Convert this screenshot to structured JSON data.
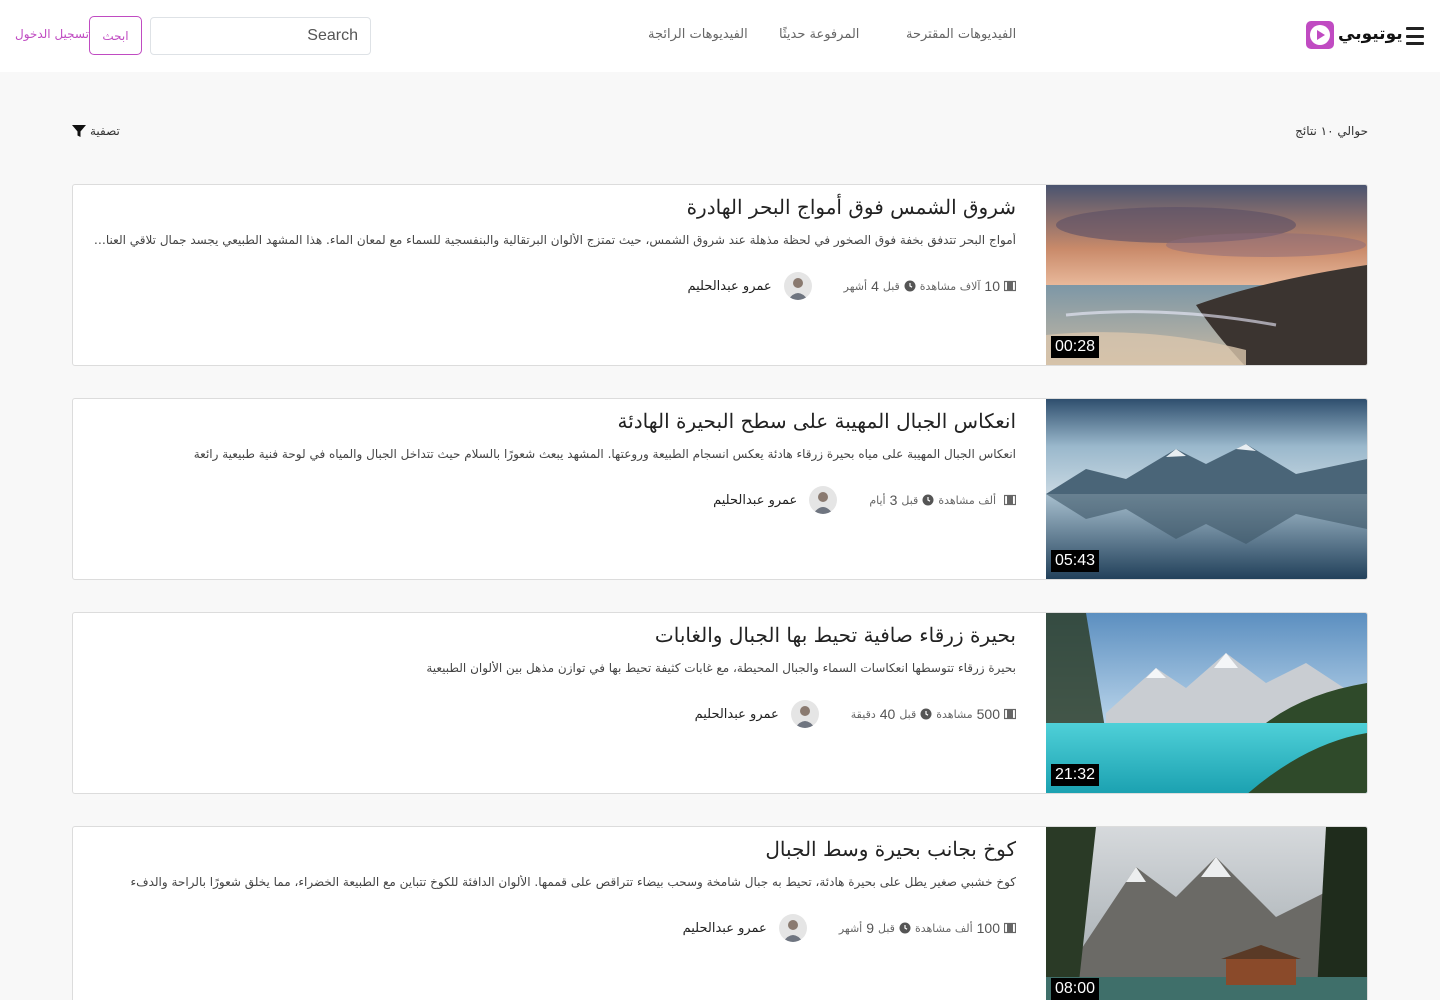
{
  "navbar": {
    "brand": "يوتيوبي",
    "colors": {
      "accent": "#c04bc2"
    },
    "links": [
      {
        "label": "الفيديوهات المقترحة"
      },
      {
        "label": "المرفوعة حديثًا"
      },
      {
        "label": "الفيديوهات الرائجة"
      }
    ],
    "search": {
      "placeholder": "Search",
      "value": "",
      "button_label": "ابحث"
    },
    "login_label": "تسجيل الدخول"
  },
  "results": {
    "count_label": "حوالي ١٠ نتائج",
    "filter_label": "تصفية"
  },
  "videos": [
    {
      "title": "شروق الشمس فوق أمواج البحر الهادرة",
      "description": "أمواج البحر تتدفق بخفة فوق الصخور في لحظة مذهلة عند شروق الشمس، حيث تمتزج الألوان البرتقالية والبنفسجية للسماء مع لمعان الماء. هذا المشهد الطبيعي يجسد جمال تلاقي العناصر الطبيعية",
      "views_num": "10",
      "views_unit": "آلاف مشاهدة",
      "time_prefix": "قبل",
      "time_num": "4",
      "time_unit": "أشهر",
      "channel": "عمرو عبدالحليم",
      "duration": "00:28"
    },
    {
      "title": "انعكاس الجبال المهيبة على سطح البحيرة الهادئة",
      "description": "انعكاس الجبال المهيبة على مياه بحيرة زرقاء هادئة يعكس انسجام الطبيعة وروعتها. المشهد يبعث شعورًا بالسلام حيث تتداخل الجبال والمياه في لوحة فنية طبيعية رائعة",
      "views_num": "",
      "views_unit": "ألف مشاهدة",
      "time_prefix": "قبل",
      "time_num": "3",
      "time_unit": "أيام",
      "channel": "عمرو عبدالحليم",
      "duration": "05:43"
    },
    {
      "title": "بحيرة زرقاء صافية تحيط بها الجبال والغابات",
      "description": "بحيرة زرقاء تتوسطها انعكاسات السماء والجبال المحيطة، مع غابات كثيفة تحيط بها في توازن مذهل بين الألوان الطبيعية",
      "views_num": "500",
      "views_unit": "مشاهدة",
      "time_prefix": "قبل",
      "time_num": "40",
      "time_unit": "دقيقة",
      "channel": "عمرو عبدالحليم",
      "duration": "21:32"
    },
    {
      "title": "كوخ بجانب بحيرة وسط الجبال",
      "description": "كوخ خشبي صغير يطل على بحيرة هادئة، تحيط به جبال شامخة وسحب بيضاء تتراقص على قممها. الألوان الدافئة للكوخ تتباين مع الطبيعة الخضراء، مما يخلق شعورًا بالراحة والدفء",
      "views_num": "100",
      "views_unit": "ألف مشاهدة",
      "time_prefix": "قبل",
      "time_num": "9",
      "time_unit": "أشهر",
      "channel": "عمرو عبدالحليم",
      "duration": "08:00"
    }
  ]
}
